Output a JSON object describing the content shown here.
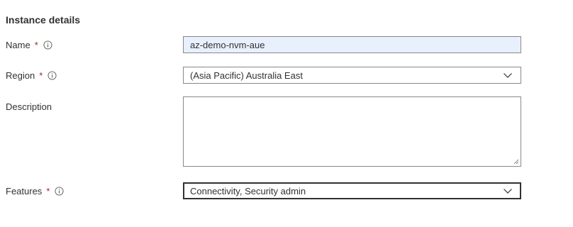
{
  "section": {
    "title": "Instance details"
  },
  "fields": {
    "name": {
      "label": "Name",
      "required_mark": "*",
      "value": "az-demo-nvm-aue"
    },
    "region": {
      "label": "Region",
      "required_mark": "*",
      "value": "(Asia Pacific) Australia East"
    },
    "description": {
      "label": "Description",
      "value": ""
    },
    "features": {
      "label": "Features",
      "required_mark": "*",
      "value": "Connectivity, Security admin"
    }
  },
  "icons": {
    "info": "info-icon",
    "dropdown": "chevron-down-icon",
    "resize": "resize-grip-icon"
  },
  "colors": {
    "required": "#a4262c",
    "autofill_background": "#e8f0fe",
    "border": "#8a8886",
    "text": "#323130"
  }
}
